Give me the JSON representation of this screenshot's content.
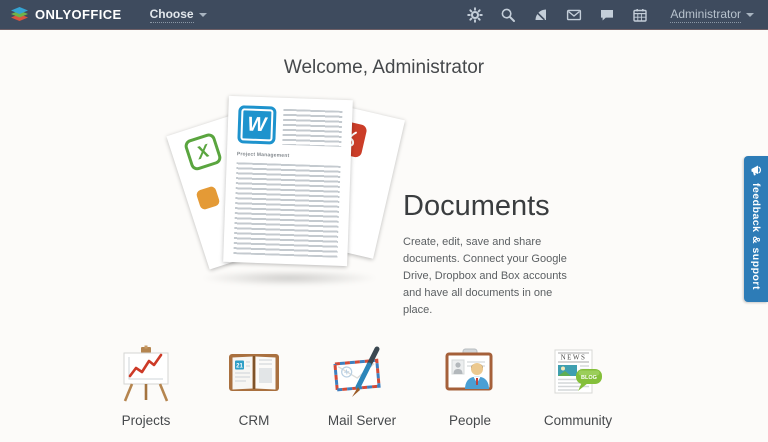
{
  "navbar": {
    "logo_text": "ONLYOFFICE",
    "choose_label": "Choose",
    "icons": [
      {
        "name": "settings-gear-icon"
      },
      {
        "name": "search-icon"
      },
      {
        "name": "feed-icon"
      },
      {
        "name": "mail-icon"
      },
      {
        "name": "talk-icon"
      },
      {
        "name": "calendar-icon"
      }
    ],
    "user_label": "Administrator"
  },
  "main": {
    "welcome_title": "Welcome, Administrator",
    "hero": {
      "title": "Documents",
      "description": "Create, edit, save and share documents. Connect your Google Drive, Dropbox and Box accounts and have all documents in one place.",
      "document_preview": {
        "word_letter": "W",
        "excel_letter": "X",
        "doc_heading": "Project Management"
      }
    },
    "modules": [
      {
        "label": "Projects"
      },
      {
        "label": "CRM",
        "icon_texts": {
          "date": "21"
        }
      },
      {
        "label": "Mail Server"
      },
      {
        "label": "People"
      },
      {
        "label": "Community",
        "icon_texts": {
          "news": "NEWS",
          "blog": "BLOG"
        }
      }
    ]
  },
  "feedback_tab": {
    "label": "feedback & support"
  },
  "colors": {
    "navbar_bg": "#3e4b5e",
    "feedback_bg": "#2d7cb7",
    "word_blue": "#1e93cd",
    "excel_green": "#5aa53f",
    "pdf_red": "#cb3d28",
    "blog_green": "#84bf3a",
    "chart_red": "#cd3a27"
  }
}
